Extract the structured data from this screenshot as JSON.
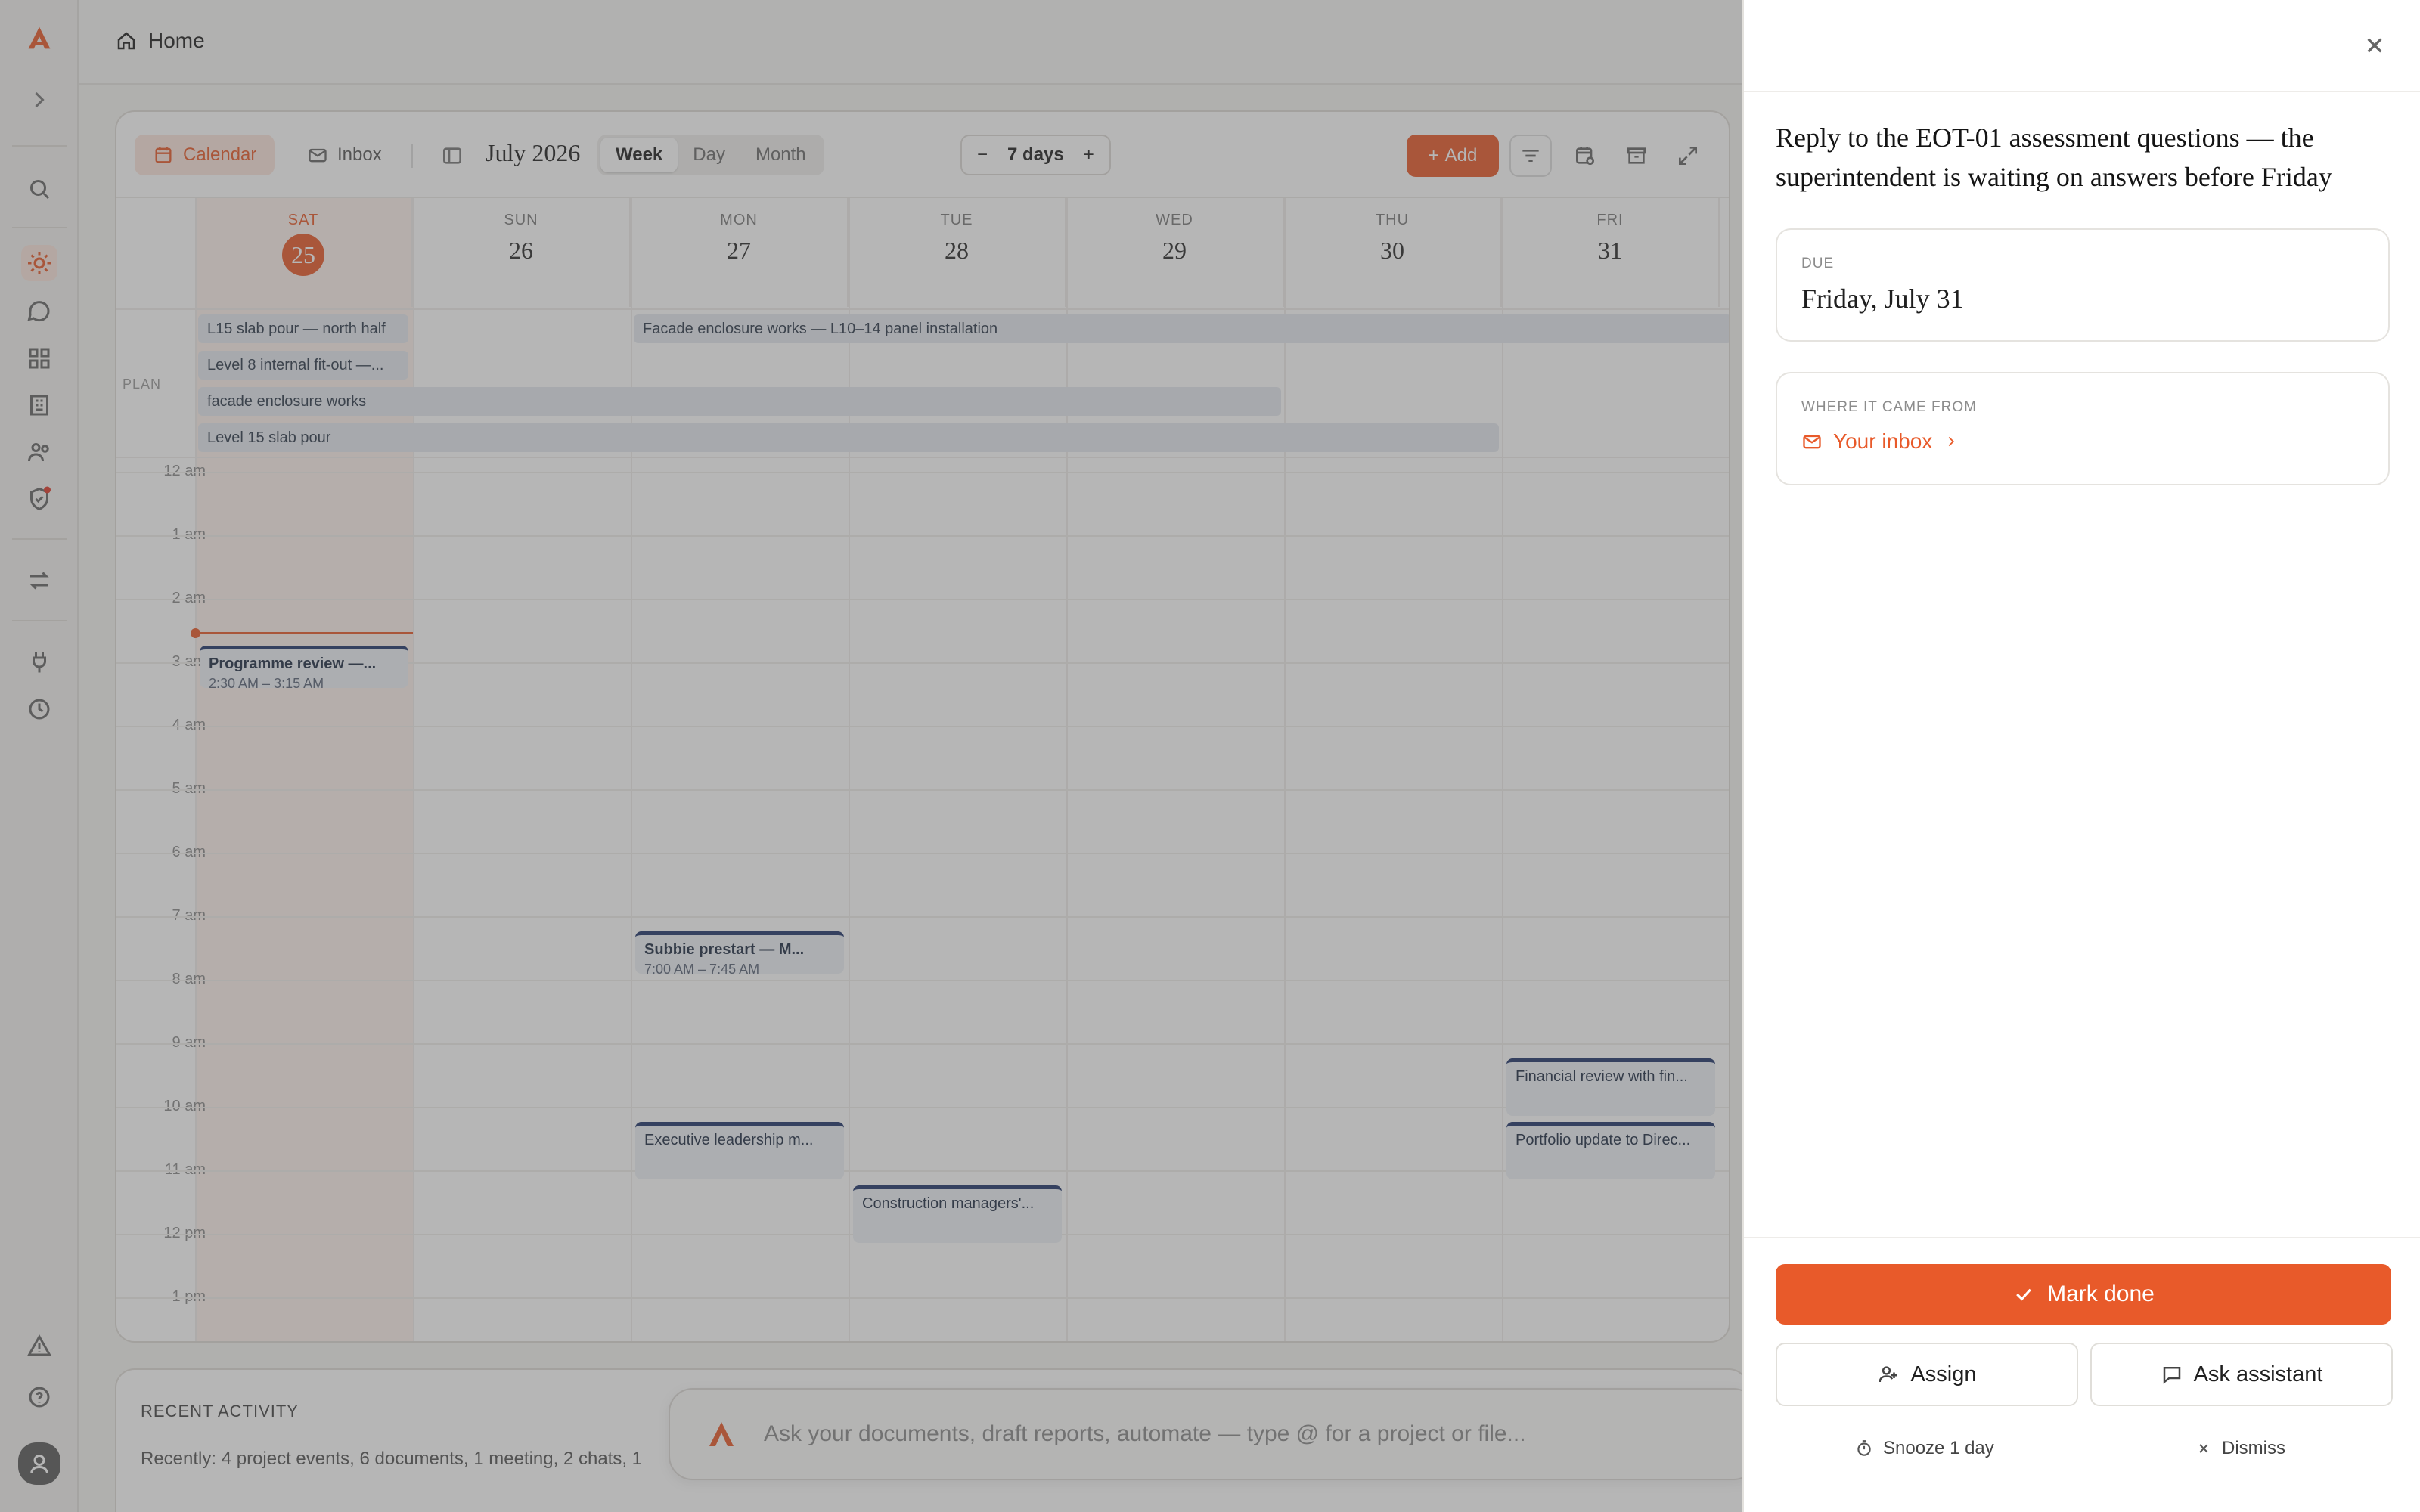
{
  "header": {
    "home_label": "Home"
  },
  "toolbar": {
    "calendar_tab": "Calendar",
    "inbox_tab": "Inbox",
    "month_label": "July 2026",
    "views": [
      "Week",
      "Day",
      "Month"
    ],
    "selected_view": "Week",
    "range_minus": "−",
    "range_label": "7 days",
    "range_plus": "+",
    "add_label": "Add"
  },
  "calendar": {
    "days": [
      {
        "name": "SAT",
        "date": "25"
      },
      {
        "name": "SUN",
        "date": "26"
      },
      {
        "name": "MON",
        "date": "27"
      },
      {
        "name": "TUE",
        "date": "28"
      },
      {
        "name": "WED",
        "date": "29"
      },
      {
        "name": "THU",
        "date": "30"
      },
      {
        "name": "FRI",
        "date": "31"
      }
    ],
    "plan_label": "PLAN",
    "plan_items": [
      "L15 slab pour — north half",
      "Facade enclosure works — L10–14 panel installation",
      "Level 8 internal fit-out —...",
      "facade enclosure works",
      "Level 15 slab pour"
    ],
    "hours": [
      "12 am",
      "1 am",
      "2 am",
      "3 am",
      "4 am",
      "5 am",
      "6 am",
      "7 am",
      "8 am",
      "9 am",
      "10 am",
      "11 am",
      "12 pm",
      "1 pm"
    ],
    "events": [
      {
        "title": "Programme review —...",
        "time": "2:30 AM – 3:15 AM"
      },
      {
        "title": "Subbie prestart — M...",
        "time": "7:00 AM – 7:45 AM"
      },
      {
        "title": "Executive leadership m...",
        "time": ""
      },
      {
        "title": "Construction managers'...",
        "time": ""
      },
      {
        "title": "Financial review with fin...",
        "time": ""
      },
      {
        "title": "Portfolio update to Direc...",
        "time": ""
      }
    ]
  },
  "recent": {
    "heading": "RECENT ACTIVITY",
    "summary": "Recently: 4 project events, 6 documents, 1 meeting, 2 chats, 1"
  },
  "ask": {
    "placeholder": "Ask your documents, draft reports, automate — type @ for a project or file..."
  },
  "panel": {
    "title": "Reply to the EOT-01 assessment questions — the superintendent is waiting on answers before Friday",
    "due_label": "DUE",
    "due_value": "Friday, July 31",
    "source_label": "WHERE IT CAME FROM",
    "source_link": "Your inbox",
    "mark_done": "Mark done",
    "assign": "Assign",
    "ask_assistant": "Ask assistant",
    "snooze": "Snooze 1 day",
    "dismiss": "Dismiss"
  },
  "colors": {
    "accent": "#e85a2a",
    "event_border": "#21366b",
    "event_bg": "#eef1f6"
  }
}
